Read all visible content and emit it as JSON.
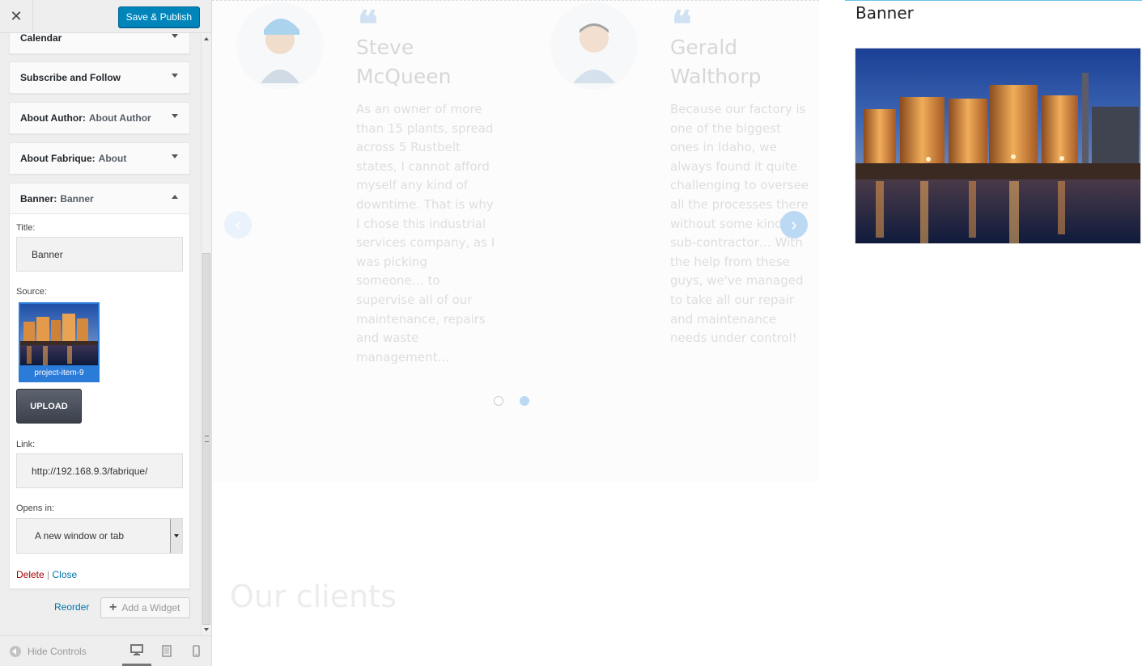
{
  "app": {
    "close_glyph": "✕",
    "publish_label": "Save & Publish"
  },
  "widgets": [
    {
      "title": "Calendar",
      "sub": ""
    },
    {
      "title": "Subscribe and Follow",
      "sub": ""
    },
    {
      "title": "About Author:",
      "sub": "About Author"
    },
    {
      "title": "About Fabrique:",
      "sub": "About"
    }
  ],
  "banner_widget": {
    "title": "Banner:",
    "sub": "Banner",
    "title_label": "Title:",
    "title_value": "Banner",
    "source_label": "Source:",
    "source_caption": "project-item-9",
    "upload_label": "UPLOAD",
    "link_label": "Link:",
    "link_value": "http://192.168.9.3/fabrique/",
    "opens_label": "Opens in:",
    "opens_value": "A new window or tab",
    "delete_label": "Delete",
    "separator": "|",
    "close_label": "Close"
  },
  "footer": {
    "reorder_label": "Reorder",
    "add_widget_label": "Add a Widget",
    "hide_controls_label": "Hide Controls"
  },
  "preview": {
    "quote_glyph": "❝",
    "testimonials": [
      {
        "name_line1": "Steve",
        "name_line2": "McQueen",
        "lines": [
          "As an owner of more",
          "than 15 plants, spread",
          "across 5 Rustbelt",
          "states, I cannot afford",
          "myself any kind of",
          "downtime. That is why",
          "I chose this industrial",
          "services company, as I",
          "was picking",
          "someone… to",
          "supervise all of our",
          "maintenance, repairs",
          "and waste",
          "management…"
        ]
      },
      {
        "name_line1": "Gerald",
        "name_line2": "Walthorp",
        "lines": [
          "Because our factory is",
          "one of the biggest",
          "ones in Idaho, we",
          "always found it quite",
          "challenging to oversee",
          "all the processes there",
          "without some kind of",
          "sub-contractor… With",
          "the help from these",
          "guys, we've managed",
          "to take all our repair",
          "and maintenance",
          "needs under control!"
        ]
      }
    ],
    "prev_glyph": "‹",
    "next_glyph": "›",
    "clients_title": "Our clients",
    "banner_title": "Banner"
  },
  "colors": {
    "accent": "#0085ba",
    "link": "#0073aa",
    "delete": "#aa0000"
  },
  "icons": [
    "close-icon",
    "chevron-down-icon",
    "chevron-up-icon",
    "plus-icon",
    "collapse-icon",
    "desktop-icon",
    "tablet-icon",
    "mobile-icon",
    "quote-icon",
    "chevron-left-icon",
    "chevron-right-icon"
  ]
}
